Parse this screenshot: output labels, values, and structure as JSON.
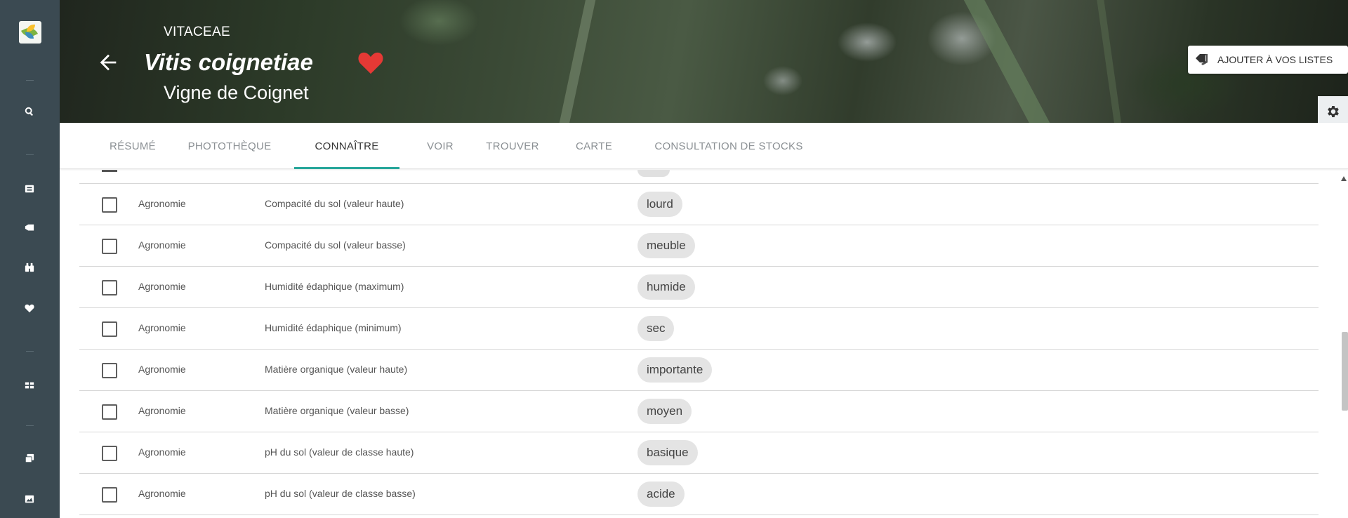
{
  "sidebar": {
    "icons": [
      "logo",
      "search-icon",
      "contact-card-icon",
      "tag-icon",
      "binoculars-icon",
      "heart-icon",
      "grid-icon",
      "window-icon",
      "image-icon"
    ]
  },
  "header": {
    "family": "VITACEAE",
    "scientific_name": "Vitis coignetiae",
    "common_name": "Vigne de Coignet",
    "add_to_lists_label": "AJOUTER À VOS LISTES",
    "heart_color": "#e53935"
  },
  "tabs": [
    {
      "label": "RÉSUMÉ",
      "active": false
    },
    {
      "label": "PHOTOTHÈQUE",
      "active": false
    },
    {
      "label": "CONNAÎTRE",
      "active": true
    },
    {
      "label": "VOIR",
      "active": false
    },
    {
      "label": "TROUVER",
      "active": false
    },
    {
      "label": "CARTE",
      "active": false
    },
    {
      "label": "CONSULTATION DE STOCKS",
      "active": false
    }
  ],
  "accent_color": "#26a69a",
  "rows": [
    {
      "category": "Agronomie",
      "property": "Compacité du sol (valeur haute)",
      "value": "lourd"
    },
    {
      "category": "Agronomie",
      "property": "Compacité du sol (valeur basse)",
      "value": "meuble"
    },
    {
      "category": "Agronomie",
      "property": "Humidité édaphique (maximum)",
      "value": "humide"
    },
    {
      "category": "Agronomie",
      "property": "Humidité édaphique (minimum)",
      "value": "sec"
    },
    {
      "category": "Agronomie",
      "property": "Matière organique (valeur haute)",
      "value": "importante"
    },
    {
      "category": "Agronomie",
      "property": "Matière organique (valeur basse)",
      "value": "moyen"
    },
    {
      "category": "Agronomie",
      "property": "pH du sol (valeur de classe haute)",
      "value": "basique"
    },
    {
      "category": "Agronomie",
      "property": "pH du sol (valeur de classe basse)",
      "value": "acide"
    }
  ]
}
